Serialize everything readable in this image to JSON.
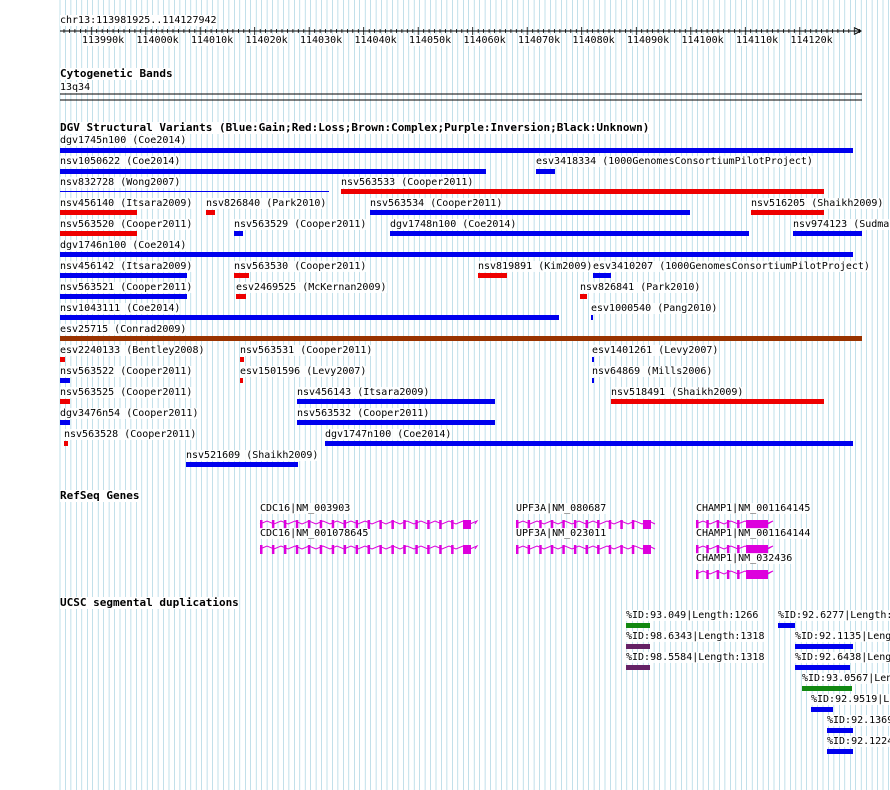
{
  "colors": {
    "gain": "#0000ee",
    "loss": "#ee0000",
    "complex": "#993300",
    "genes": "#dd00dd",
    "grid": "#99ccdd",
    "seg_green": "#118811",
    "seg_purple": "#662266"
  },
  "ruler": {
    "position": "chr13:113981925..114127942",
    "ticks": [
      "113990k",
      "114000k",
      "114010k",
      "114020k",
      "114030k",
      "114040k",
      "114050k",
      "114060k",
      "114070k",
      "114080k",
      "114090k",
      "114100k",
      "114110k",
      "114120k"
    ]
  },
  "cytoband": {
    "title": "Cytogenetic Bands",
    "band": "13q34"
  },
  "dgv": {
    "title": "DGV Structural Variants (Blue:Gain;Red:Loss;Brown:Complex;Purple:Inversion;Black:Unknown)",
    "variants": [
      {
        "name": "dgv1745n100 (Coe2014)",
        "type": "gain"
      },
      {
        "name": "nsv1050622 (Coe2014)",
        "type": "gain"
      },
      {
        "name": "esv3418334 (1000GenomesConsortiumPilotProject)",
        "type": "gain"
      },
      {
        "name": "nsv832728 (Wong2007)",
        "type": "gain"
      },
      {
        "name": "nsv563533 (Cooper2011)",
        "type": "loss"
      },
      {
        "name": "nsv456140 (Itsara2009)",
        "type": "loss"
      },
      {
        "name": "nsv826840 (Park2010)",
        "type": "loss"
      },
      {
        "name": "nsv563534 (Cooper2011)",
        "type": "gain"
      },
      {
        "name": "nsv516205 (Shaikh2009)",
        "type": "loss"
      },
      {
        "name": "nsv563520 (Cooper2011)",
        "type": "loss"
      },
      {
        "name": "nsv563529 (Cooper2011)",
        "type": "gain"
      },
      {
        "name": "dgv1748n100 (Coe2014)",
        "type": "gain"
      },
      {
        "name": "nsv974123 (Sudmant",
        "type": "gain"
      },
      {
        "name": "dgv1746n100 (Coe2014)",
        "type": "gain"
      },
      {
        "name": "nsv456142 (Itsara2009)",
        "type": "gain"
      },
      {
        "name": "nsv563530 (Cooper2011)",
        "type": "loss"
      },
      {
        "name": "nsv819891 (Kim2009)",
        "type": "loss"
      },
      {
        "name": "esv3410207 (1000GenomesConsortiumPilotProject)",
        "type": "gain"
      },
      {
        "name": "nsv563521 (Cooper2011)",
        "type": "gain"
      },
      {
        "name": "esv2469525 (McKernan2009)",
        "type": "loss"
      },
      {
        "name": "nsv826841 (Park2010)",
        "type": "loss"
      },
      {
        "name": "nsv1043111 (Coe2014)",
        "type": "gain"
      },
      {
        "name": "esv1000540 (Pang2010)",
        "type": "gain"
      },
      {
        "name": "esv25715 (Conrad2009)",
        "type": "complex"
      },
      {
        "name": "esv2240133 (Bentley2008)",
        "type": "loss"
      },
      {
        "name": "nsv563531 (Cooper2011)",
        "type": "loss"
      },
      {
        "name": "esv1401261 (Levy2007)",
        "type": "gain"
      },
      {
        "name": "nsv563522 (Cooper2011)",
        "type": "gain"
      },
      {
        "name": "esv1501596 (Levy2007)",
        "type": "loss"
      },
      {
        "name": "nsv64869 (Mills2006)",
        "type": "gain"
      },
      {
        "name": "nsv563525 (Cooper2011)",
        "type": "loss"
      },
      {
        "name": "nsv456143 (Itsara2009)",
        "type": "gain"
      },
      {
        "name": "nsv518491 (Shaikh2009)",
        "type": "loss"
      },
      {
        "name": "dgv3476n54 (Cooper2011)",
        "type": "gain"
      },
      {
        "name": "nsv563532 (Cooper2011)",
        "type": "gain"
      },
      {
        "name": "nsv563528 (Cooper2011)",
        "type": "loss"
      },
      {
        "name": "dgv1747n100 (Coe2014)",
        "type": "gain"
      },
      {
        "name": "nsv521609 (Shaikh2009)",
        "type": "gain"
      }
    ]
  },
  "refseq": {
    "title": "RefSeq Genes",
    "genes": [
      "CDC16|NM_003903",
      "CDC16|NM_001078645",
      "UPF3A|NM_080687",
      "UPF3A|NM_023011",
      "CHAMP1|NM_001164145",
      "CHAMP1|NM_001164144",
      "CHAMP1|NM_032436"
    ]
  },
  "segdup": {
    "title": "UCSC segmental duplications",
    "items": [
      {
        "label": "%ID:93.049|Length:1266",
        "color": "seg_green"
      },
      {
        "label": "%ID:98.6343|Length:1318",
        "color": "seg_purple"
      },
      {
        "label": "%ID:98.5584|Length:1318",
        "color": "seg_purple"
      },
      {
        "label": "%ID:92.6277|Length:",
        "color": "gain"
      },
      {
        "label": "%ID:92.1135|Leng",
        "color": "gain"
      },
      {
        "label": "%ID:92.6438|Leng",
        "color": "gain"
      },
      {
        "label": "%ID:93.0567|Len",
        "color": "seg_green"
      },
      {
        "label": "%ID:92.9519|L",
        "color": "gain"
      },
      {
        "label": "%ID:92.1369",
        "color": "gain"
      },
      {
        "label": "%ID:92.1224",
        "color": "gain"
      }
    ]
  }
}
